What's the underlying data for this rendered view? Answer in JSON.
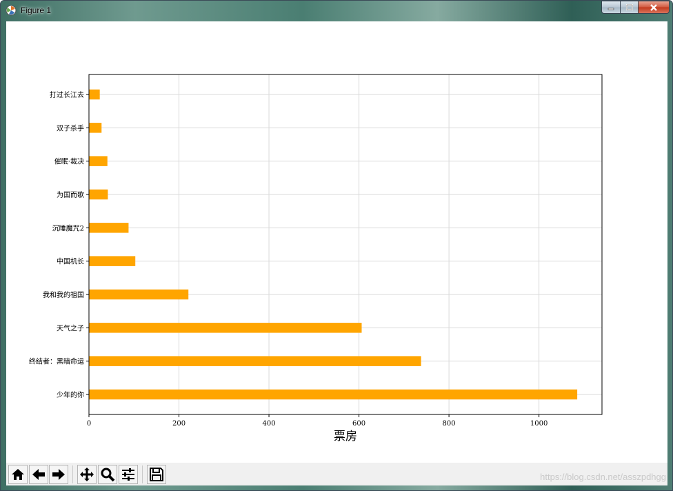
{
  "window": {
    "title": "Figure 1"
  },
  "toolbar": {
    "buttons": [
      "home-icon",
      "back-icon",
      "forward-icon",
      "pan-icon",
      "zoom-icon",
      "configure-icon",
      "save-icon"
    ]
  },
  "watermark": "https://blog.csdn.net/asszpdhgg",
  "colors": {
    "bar": "#ffa500",
    "grid": "#d9d9d9",
    "axes": "#000000"
  },
  "chart_data": {
    "type": "bar",
    "orientation": "horizontal",
    "categories": [
      "少年的你",
      "终结者：黑暗命运",
      "天气之子",
      "我和我的祖国",
      "中国机长",
      "沉睡魔咒2",
      "为国而歌",
      "催眠·裁决",
      "双子杀手",
      "打过长江去"
    ],
    "values": [
      1085,
      738,
      606,
      221,
      103,
      88,
      42,
      41,
      28,
      24
    ],
    "xlabel": "票房",
    "ylabel": "",
    "title": "",
    "xlim": [
      0,
      1140
    ],
    "xticks": [
      0,
      200,
      400,
      600,
      800,
      1000
    ],
    "grid": true
  }
}
